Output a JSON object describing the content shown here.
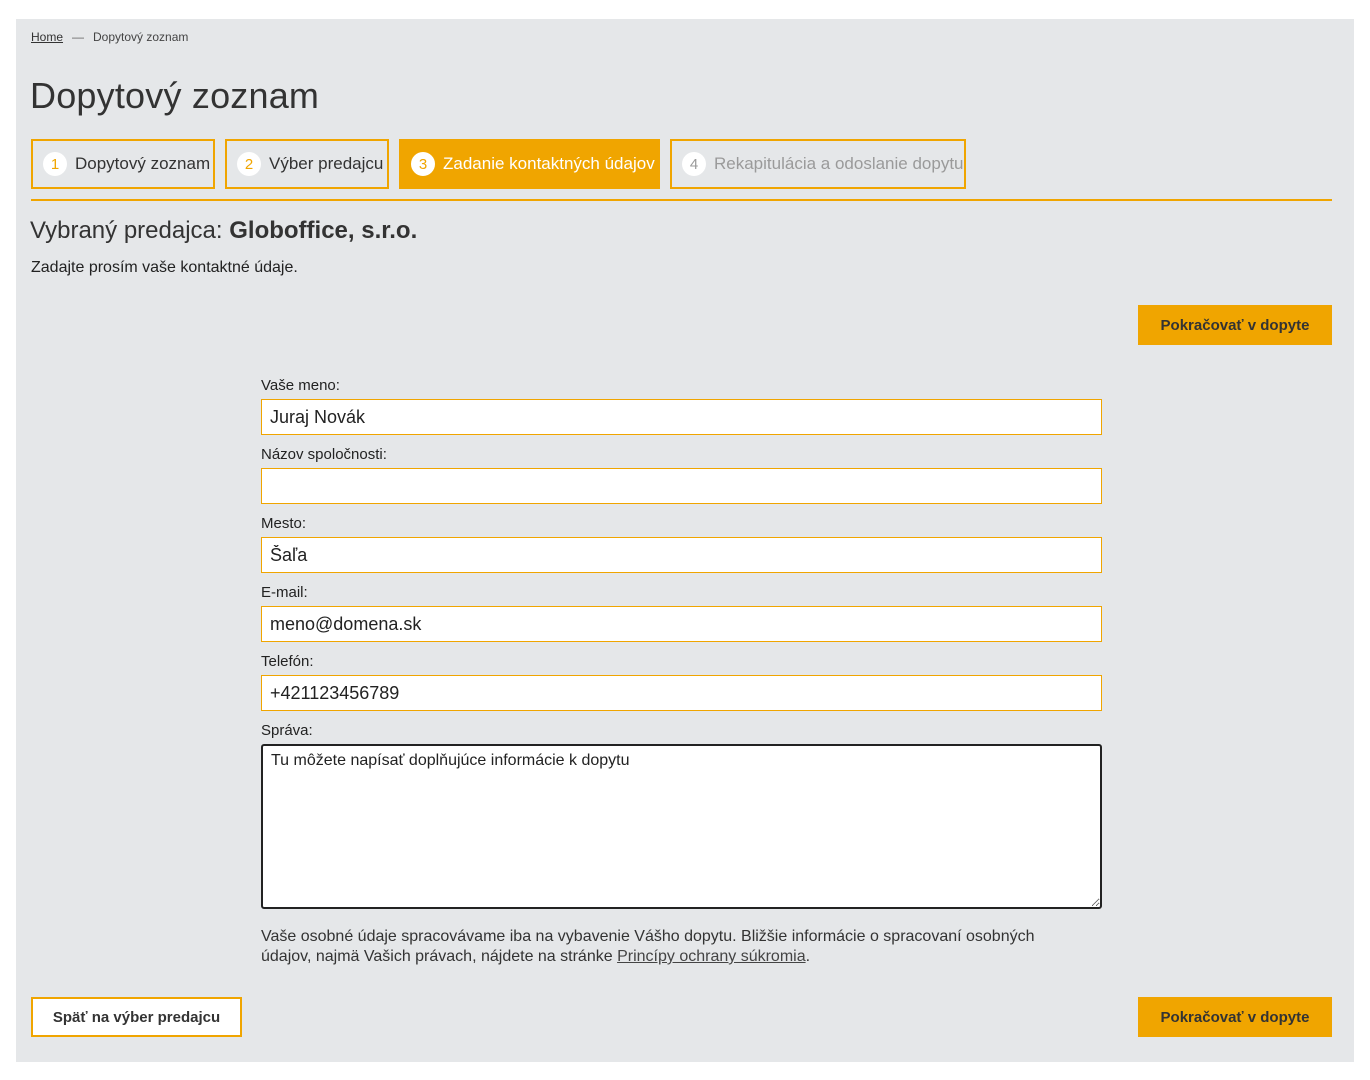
{
  "breadcrumb": {
    "home": "Home",
    "separator": "—",
    "current": "Dopytový zoznam"
  },
  "page_title": "Dopytový zoznam",
  "steps": [
    {
      "num": "1",
      "label": "Dopytový zoznam"
    },
    {
      "num": "2",
      "label": "Výber predajcu"
    },
    {
      "num": "3",
      "label": "Zadanie kontaktných údajov"
    },
    {
      "num": "4",
      "label": "Rekapitulácia a odoslanie dopytu"
    }
  ],
  "vendor": {
    "prefix": "Vybraný predajca:",
    "name": "Globoffice, s.r.o."
  },
  "intro": "Zadajte prosím vaše kontaktné údaje.",
  "continue_label": "Pokračovať v dopyte",
  "back_label": "Späť na výber predajcu",
  "form": {
    "name": {
      "label": "Vaše meno:",
      "value": "Juraj Novák"
    },
    "company": {
      "label": "Názov spoločnosti:",
      "value": ""
    },
    "city": {
      "label": "Mesto:",
      "value": "Šaľa"
    },
    "email": {
      "label": "E-mail:",
      "value": "meno@domena.sk"
    },
    "phone": {
      "label": "Telefón:",
      "value": "+421123456789"
    },
    "message": {
      "label": "Správa:",
      "value": "Tu môžete napísať doplňujúce informácie k dopytu"
    }
  },
  "privacy": {
    "text": "Vaše osobné údaje spracovávame iba na vybavenie Vášho dopytu. Bližšie informácie o spracovaní osobných údajov, najmä Vašich právach, nájdete na stránke",
    "link": "Princípy ochrany súkromia",
    "end": "."
  },
  "colors": {
    "accent": "#f0a500",
    "panel": "#e5e7e9"
  }
}
